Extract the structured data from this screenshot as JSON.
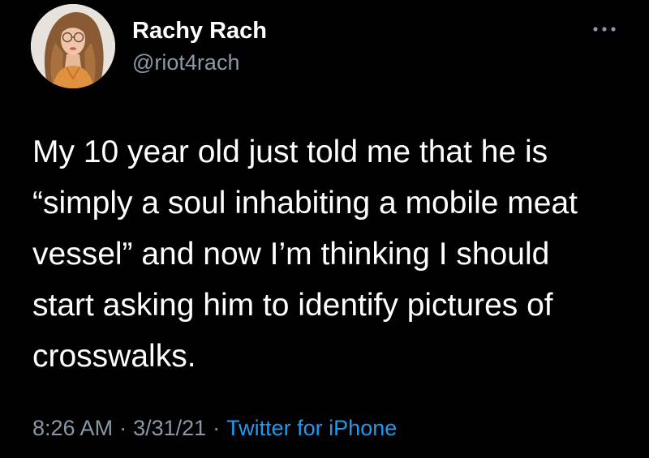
{
  "tweet": {
    "author": {
      "display_name": "Rachy Rach",
      "handle": "@riot4rach",
      "avatar_icon": "profile-photo"
    },
    "more_icon": "more-options-icon",
    "text_lines": [
      "My 10 year old just told me that he is",
      "“simply a soul inhabiting a mobile meat",
      "vessel” and now I’m thinking I should",
      "start asking him to identify pictures of",
      "crosswalks."
    ],
    "time": "8:26 AM",
    "separator": "·",
    "date": "3/31/21",
    "source": "Twitter for iPhone"
  },
  "colors": {
    "background": "#000000",
    "text": "#ffffff",
    "secondary_text": "#8b98a5",
    "link": "#1d9bf0"
  }
}
